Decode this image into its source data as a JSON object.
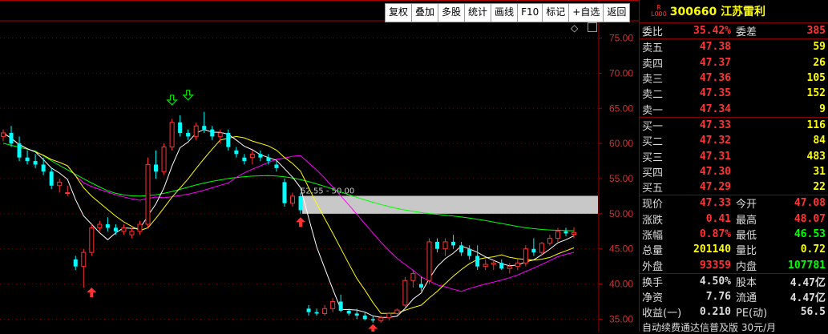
{
  "toolbar": [
    "复权",
    "叠加",
    "多股",
    "统计",
    "画线",
    "F10",
    "标记",
    "+自选",
    "返回"
  ],
  "stock": {
    "badge_top": "R",
    "badge_bottom": "L000",
    "code": "300660",
    "name": "江苏雷利"
  },
  "ratio": {
    "label1": "委比",
    "value1": "35.42%",
    "label2": "委差",
    "value2": "385"
  },
  "asks": [
    {
      "label": "卖五",
      "price": "47.38",
      "vol": "59"
    },
    {
      "label": "卖四",
      "price": "47.37",
      "vol": "26"
    },
    {
      "label": "卖三",
      "price": "47.36",
      "vol": "105"
    },
    {
      "label": "卖二",
      "price": "47.35",
      "vol": "152"
    },
    {
      "label": "卖一",
      "price": "47.34",
      "vol": "9"
    }
  ],
  "bids": [
    {
      "label": "买一",
      "price": "47.33",
      "vol": "116"
    },
    {
      "label": "买二",
      "price": "47.32",
      "vol": "84"
    },
    {
      "label": "买三",
      "price": "47.31",
      "vol": "483"
    },
    {
      "label": "买四",
      "price": "47.30",
      "vol": "31"
    },
    {
      "label": "买五",
      "price": "47.29",
      "vol": "22"
    }
  ],
  "quote": [
    {
      "l1": "现价",
      "v1": "47.33",
      "c1": "red",
      "l2": "今开",
      "v2": "47.08",
      "c2": "red"
    },
    {
      "l1": "涨跌",
      "v1": "0.41",
      "c1": "red",
      "l2": "最高",
      "v2": "48.07",
      "c2": "red"
    },
    {
      "l1": "涨幅",
      "v1": "0.87%",
      "c1": "red",
      "l2": "最低",
      "v2": "46.53",
      "c2": "grn"
    },
    {
      "l1": "总量",
      "v1": "201140",
      "c1": "yel",
      "l2": "量比",
      "v2": "0.72",
      "c2": "yel"
    },
    {
      "l1": "外盘",
      "v1": "93359",
      "c1": "red",
      "l2": "内盘",
      "v2": "107781",
      "c2": "grn"
    }
  ],
  "fundamentals": [
    {
      "l1": "换手",
      "v1": "4.50%",
      "l2": "股本",
      "v2": "4.47亿"
    },
    {
      "l1": "净资",
      "v1": "7.76",
      "l2": "流通",
      "v2": "4.47亿"
    },
    {
      "l1": "收益(一)",
      "v1": "0.210",
      "l2": "PE(动)",
      "v2": "56.5"
    }
  ],
  "ad_text": "自动续费通达信普及版 30元/月",
  "chart_data": {
    "type": "candlestick",
    "y_ticks": [
      "75.00",
      "70.00",
      "65.00",
      "60.00",
      "55.00",
      "50.00",
      "45.00",
      "40.00",
      "35.00"
    ],
    "ylim": [
      33.0,
      77.0
    ],
    "range_label": "52.55 - 50.00",
    "colors": {
      "up": "#ff3232",
      "down": "#00ffff",
      "ma5": "#ffffff",
      "ma10": "#ffff00",
      "ma20": "#ff00ff",
      "ma60": "#00ff00",
      "band": "#c8c8c8"
    },
    "candles": [
      [
        61,
        62,
        60.3,
        61.5
      ],
      [
        61.5,
        62.5,
        59.5,
        60
      ],
      [
        60,
        61,
        57.5,
        58
      ],
      [
        58,
        59,
        57,
        57.5
      ],
      [
        57.5,
        58.5,
        56.5,
        57
      ],
      [
        57,
        58,
        55.5,
        56
      ],
      [
        56,
        56.5,
        53.5,
        54
      ],
      [
        54,
        55,
        53,
        54.5
      ],
      [
        53,
        54,
        52.5,
        53
      ],
      [
        43.5,
        44,
        42,
        42.5
      ],
      [
        42.5,
        45,
        39.5,
        44.5
      ],
      [
        44.5,
        48.5,
        44,
        48
      ],
      [
        48,
        49,
        47.5,
        48.5
      ],
      [
        48.5,
        49.5,
        47.5,
        48
      ],
      [
        48,
        48.5,
        47,
        47.5
      ],
      [
        47.5,
        48.5,
        47,
        48
      ],
      [
        47,
        48,
        46.5,
        47.5
      ],
      [
        47.5,
        49,
        47,
        48.5
      ],
      [
        48.5,
        58,
        48,
        57
      ],
      [
        57,
        59,
        55,
        56
      ],
      [
        56,
        60,
        55.5,
        59.5
      ],
      [
        59.5,
        63.5,
        59,
        63
      ],
      [
        63,
        64,
        61,
        61.5
      ],
      [
        61.5,
        62,
        60.5,
        61
      ],
      [
        61,
        63,
        60.5,
        62.5
      ],
      [
        62.5,
        64.5,
        61.5,
        62
      ],
      [
        62,
        62.5,
        60.5,
        61
      ],
      [
        61,
        62,
        60,
        61.5
      ],
      [
        61.5,
        62,
        59,
        59.5
      ],
      [
        59,
        59.5,
        58,
        58.5
      ],
      [
        58,
        58.5,
        57,
        57.5
      ],
      [
        58,
        59,
        57,
        58.5
      ],
      [
        58.5,
        59,
        57.5,
        58
      ],
      [
        58,
        58.5,
        57,
        57.5
      ],
      [
        57,
        57.5,
        56,
        56.5
      ],
      [
        54.5,
        55,
        51,
        51.5
      ],
      [
        51.5,
        53,
        51,
        52.5
      ],
      [
        52.5,
        53,
        50,
        50.5
      ],
      [
        36.5,
        37,
        35.5,
        36
      ],
      [
        36,
        36.5,
        35.5,
        35.8
      ],
      [
        35.8,
        37,
        35.5,
        36.5
      ],
      [
        36.5,
        38,
        36,
        37.5
      ],
      [
        37.5,
        38.5,
        36,
        36.2
      ],
      [
        36.2,
        36.5,
        35.5,
        35.8
      ],
      [
        35.8,
        36.5,
        35,
        35.5
      ],
      [
        35.5,
        36,
        34.8,
        35
      ],
      [
        35,
        35.5,
        34.5,
        34.8
      ],
      [
        34.8,
        35.5,
        34.5,
        35.2
      ],
      [
        35.2,
        36,
        34.8,
        35.8
      ],
      [
        35.8,
        36.5,
        35.5,
        36.3
      ],
      [
        37,
        41,
        36.5,
        40.5
      ],
      [
        40.5,
        42,
        39.5,
        41.5
      ],
      [
        40,
        41,
        39,
        39.5
      ],
      [
        40.5,
        46.5,
        40,
        46
      ],
      [
        46,
        46.5,
        44.5,
        45
      ],
      [
        45,
        46.5,
        44,
        46
      ],
      [
        46,
        47,
        45,
        45.5
      ],
      [
        45.5,
        46,
        44,
        44.5
      ],
      [
        45,
        45.5,
        43.5,
        44
      ],
      [
        44,
        45.5,
        42,
        42.5
      ],
      [
        42.5,
        43.5,
        42,
        42.8
      ],
      [
        42.8,
        43.5,
        42,
        43
      ],
      [
        43,
        43.5,
        42,
        42.2
      ],
      [
        42.2,
        43,
        41.5,
        42.5
      ],
      [
        42.5,
        43.5,
        42,
        43
      ],
      [
        43,
        45.5,
        42.5,
        45
      ],
      [
        45,
        46.5,
        44,
        44.5
      ],
      [
        44.5,
        46,
        44,
        45.8
      ],
      [
        45.8,
        47,
        45.5,
        46.5
      ],
      [
        46.5,
        48,
        46,
        47.5
      ],
      [
        47.5,
        48,
        46.8,
        47.2
      ],
      [
        47.08,
        48.07,
        46.53,
        47.33
      ]
    ],
    "marks": [
      {
        "type": "down-arrow",
        "index": 21,
        "price": 65.5,
        "color": "#00ff00"
      },
      {
        "type": "down-arrow",
        "index": 23,
        "price": 66.2,
        "color": "#00ff00"
      },
      {
        "type": "up-arrow",
        "index": 11,
        "price": 39.5,
        "color": "#ff3232"
      },
      {
        "type": "up-arrow",
        "index": 37,
        "price": 49.5,
        "color": "#ff3232"
      },
      {
        "type": "up-arrow",
        "index": 46,
        "price": 34.3,
        "color": "#ff3232"
      }
    ]
  }
}
